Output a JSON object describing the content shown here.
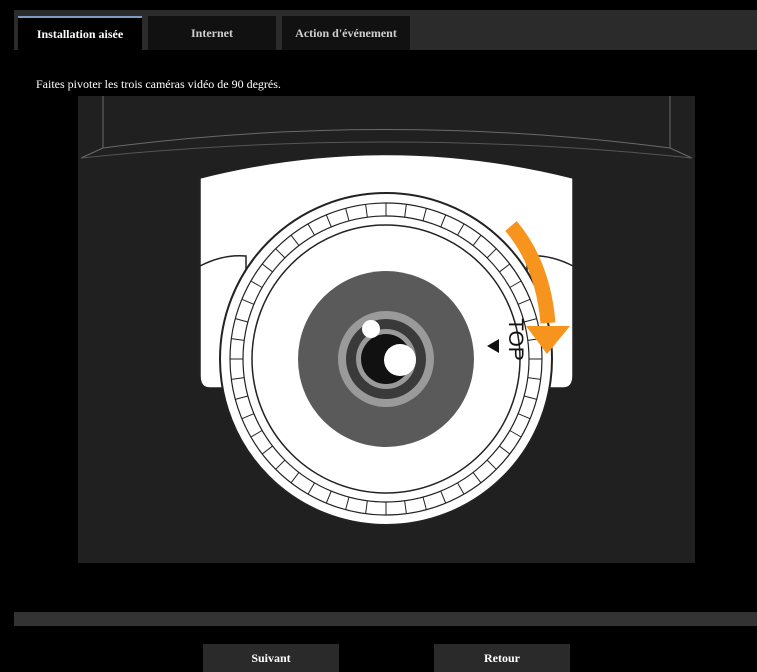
{
  "tabs": [
    {
      "label": "Installation aisée",
      "active": true
    },
    {
      "label": "Internet",
      "active": false
    },
    {
      "label": "Action d'événement",
      "active": false
    }
  ],
  "instruction": "Faites pivoter les trois caméras vidéo de 90 degrés.",
  "illustration": {
    "marker_label": "TOP",
    "arrow_color": "#f7941d",
    "rotation_degrees": 90
  },
  "buttons": {
    "next_label": "Suivant",
    "back_label": "Retour"
  }
}
